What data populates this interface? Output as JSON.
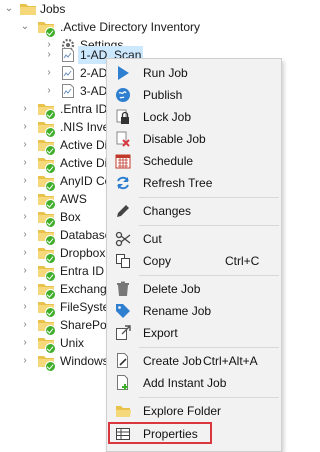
{
  "tree": {
    "root_label": "Jobs",
    "inventory_label": ".Active Directory Inventory",
    "settings_label": "Settings",
    "jobs": [
      "1-AD_Scan",
      "2-AD_",
      "3-AD_"
    ],
    "folders": [
      ".Entra ID",
      ".NIS Inven",
      "Active Dire",
      "Active Dire",
      "AnyID Con",
      "AWS",
      "Box",
      "Databases",
      "Dropbox",
      "Entra ID",
      "Exchange",
      "FileSystem",
      "SharePoin",
      "Unix",
      "Windows"
    ]
  },
  "context_menu": {
    "items": {
      "run_job": "Run Job",
      "publish": "Publish",
      "lock_job": "Lock Job",
      "disable_job": "Disable Job",
      "schedule": "Schedule",
      "refresh_tree": "Refresh Tree",
      "changes": "Changes",
      "cut": "Cut",
      "copy": "Copy",
      "copy_shortcut": "Ctrl+C",
      "delete_job": "Delete Job",
      "rename_job": "Rename Job",
      "export": "Export",
      "create_job": "Create Job",
      "create_job_shortcut": "Ctrl+Alt+A",
      "add_instant_job": "Add Instant Job",
      "explore_folder": "Explore Folder",
      "properties": "Properties"
    }
  },
  "colors": {
    "folder": "#e8c24a",
    "check": "#3fae2a",
    "selection": "#cce8ff",
    "menu_background": "#f2f2f2",
    "highlight": "#d9363e"
  }
}
